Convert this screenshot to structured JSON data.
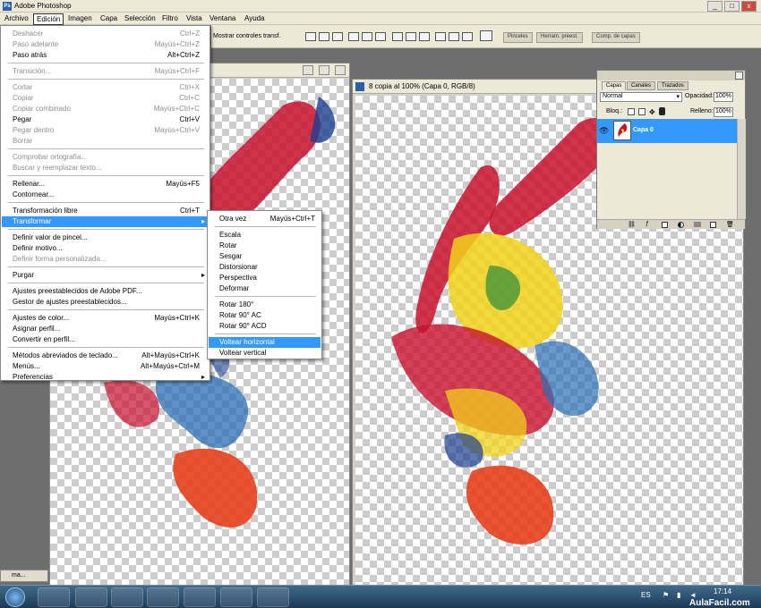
{
  "app": {
    "title": "Adobe Photoshop",
    "ps_badge": "Ps",
    "win_min": "_",
    "win_max": "□",
    "win_close": "x"
  },
  "menubar": [
    "Archivo",
    "Edición",
    "Imagen",
    "Capa",
    "Selección",
    "Filtro",
    "Vista",
    "Ventana",
    "Ayuda"
  ],
  "optionsbar": {
    "transform_label": "Mostrar controles transf.",
    "tabs": [
      "Pinceles",
      "Herram. preest.",
      "Comp. de capas"
    ]
  },
  "edit_menu": [
    {
      "label": "Deshacer",
      "shortcut": "Ctrl+Z",
      "disabled": true
    },
    {
      "label": "Paso adelante",
      "shortcut": "Mayús+Ctrl+Z",
      "disabled": true
    },
    {
      "label": "Paso atrás",
      "shortcut": "Alt+Ctrl+Z",
      "disabled": false
    },
    {
      "sep": true
    },
    {
      "label": "Transición...",
      "shortcut": "Mayús+Ctrl+F",
      "disabled": true
    },
    {
      "sep": true
    },
    {
      "label": "Cortar",
      "shortcut": "Ctrl+X",
      "disabled": true
    },
    {
      "label": "Copiar",
      "shortcut": "Ctrl+C",
      "disabled": true
    },
    {
      "label": "Copiar combinado",
      "shortcut": "Mayús+Ctrl+C",
      "disabled": true
    },
    {
      "label": "Pegar",
      "shortcut": "Ctrl+V",
      "disabled": false
    },
    {
      "label": "Pegar dentro",
      "shortcut": "Mayús+Ctrl+V",
      "disabled": true
    },
    {
      "label": "Borrar",
      "shortcut": "",
      "disabled": true
    },
    {
      "sep": true
    },
    {
      "label": "Comprobar ortografía...",
      "shortcut": "",
      "disabled": true
    },
    {
      "label": "Buscar y reemplazar texto...",
      "shortcut": "",
      "disabled": true
    },
    {
      "sep": true
    },
    {
      "label": "Rellenar...",
      "shortcut": "Mayús+F5",
      "disabled": false
    },
    {
      "label": "Contornear...",
      "shortcut": "",
      "disabled": false
    },
    {
      "sep": true
    },
    {
      "label": "Transformación libre",
      "shortcut": "Ctrl+T",
      "disabled": false
    },
    {
      "label": "Transformar",
      "shortcut": "",
      "disabled": false,
      "highlight": true,
      "submenu": true
    },
    {
      "sep": true
    },
    {
      "label": "Definir valor de pincel...",
      "shortcut": "",
      "disabled": false
    },
    {
      "label": "Definir motivo...",
      "shortcut": "",
      "disabled": false
    },
    {
      "label": "Definir forma personalizada...",
      "shortcut": "",
      "disabled": true
    },
    {
      "sep": true
    },
    {
      "label": "Purgar",
      "shortcut": "",
      "disabled": false,
      "submenu": true
    },
    {
      "sep": true
    },
    {
      "label": "Ajustes preestablecidos de Adobe PDF...",
      "shortcut": "",
      "disabled": false
    },
    {
      "label": "Gestor de ajustes preestablecidos...",
      "shortcut": "",
      "disabled": false
    },
    {
      "sep": true
    },
    {
      "label": "Ajustes de color...",
      "shortcut": "Mayús+Ctrl+K",
      "disabled": false
    },
    {
      "label": "Asignar perfil...",
      "shortcut": "",
      "disabled": false
    },
    {
      "label": "Convertir en perfil...",
      "shortcut": "",
      "disabled": false
    },
    {
      "sep": true
    },
    {
      "label": "Métodos abreviados de teclado...",
      "shortcut": "Alt+Mayús+Ctrl+K",
      "disabled": false
    },
    {
      "label": "Menús...",
      "shortcut": "Alt+Mayús+Ctrl+M",
      "disabled": false
    },
    {
      "label": "Preferencias",
      "shortcut": "",
      "disabled": false,
      "submenu": true
    }
  ],
  "transform_menu": [
    {
      "label": "Otra vez",
      "shortcut": "Mayús+Ctrl+T"
    },
    {
      "sep": true
    },
    {
      "label": "Escala",
      "shortcut": ""
    },
    {
      "label": "Rotar",
      "shortcut": ""
    },
    {
      "label": "Sesgar",
      "shortcut": ""
    },
    {
      "label": "Distorsionar",
      "shortcut": ""
    },
    {
      "label": "Perspectiva",
      "shortcut": ""
    },
    {
      "label": "Deformar",
      "shortcut": ""
    },
    {
      "sep": true
    },
    {
      "label": "Rotar 180°",
      "shortcut": ""
    },
    {
      "label": "Rotar 90° AC",
      "shortcut": ""
    },
    {
      "label": "Rotar 90° ACD",
      "shortcut": ""
    },
    {
      "sep": true
    },
    {
      "label": "Voltear horizontal",
      "shortcut": "",
      "highlight": true
    },
    {
      "label": "Voltear vertical",
      "shortcut": ""
    }
  ],
  "doc2": {
    "title": "8 copia al 100% (Capa 0, RGB/8)"
  },
  "doc_mini": {
    "label": "ma..."
  },
  "layers": {
    "tabs": [
      "Capas",
      "Canales",
      "Trazados"
    ],
    "blend": "Normal",
    "opacity_label": "Opacidad:",
    "opacity": "100%",
    "lock_label": "Bloq.:",
    "fill_label": "Relleno:",
    "fill": "100%",
    "layer_name": "Capa 0"
  },
  "taskbar": {
    "lang": "ES",
    "time": "17:14",
    "brand": "AulaFacil.com"
  },
  "colors": {
    "accent": "#3399ff",
    "chrome": "#ece9d8"
  }
}
